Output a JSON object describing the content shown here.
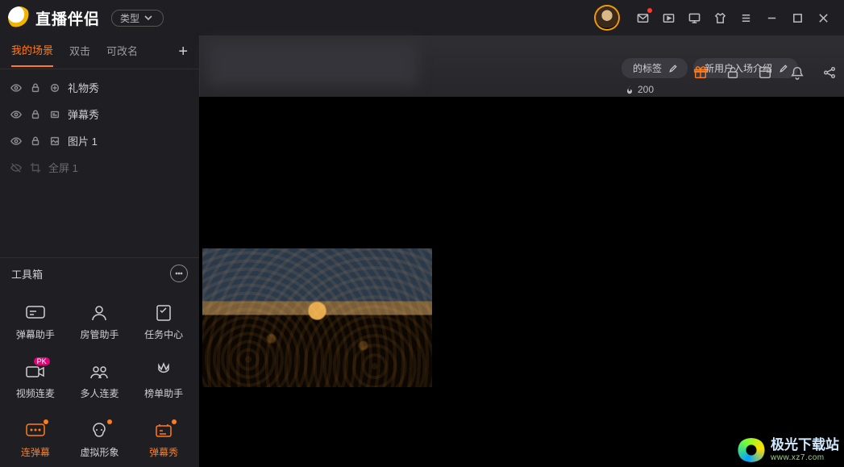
{
  "app": {
    "title": "直播伴侣",
    "type_label": "类型"
  },
  "titlebar_icons": [
    "mail",
    "video-play",
    "monitor",
    "shirt",
    "menu",
    "minimize",
    "maximize",
    "close"
  ],
  "sidebar": {
    "tabs": [
      {
        "label": "我的场景",
        "active": true
      },
      {
        "label": "双击",
        "active": false
      },
      {
        "label": "可改名",
        "active": false
      }
    ],
    "layers": [
      {
        "name": "礼物秀",
        "visible": true,
        "locked": true,
        "type": "gift"
      },
      {
        "name": "弹幕秀",
        "visible": true,
        "locked": true,
        "type": "danmu"
      },
      {
        "name": "图片 1",
        "visible": true,
        "locked": true,
        "type": "image"
      },
      {
        "name": "全屏 1",
        "visible": false,
        "locked": false,
        "type": "fullscreen",
        "dim": true
      }
    ]
  },
  "toolbox": {
    "title": "工具箱",
    "items": [
      {
        "label": "弹幕助手",
        "icon": "danmu-assistant"
      },
      {
        "label": "房管助手",
        "icon": "room-admin"
      },
      {
        "label": "任务中心",
        "icon": "task-center"
      },
      {
        "label": "视频连麦",
        "icon": "video-link",
        "badge": "PK"
      },
      {
        "label": "多人连麦",
        "icon": "multi-link"
      },
      {
        "label": "榜单助手",
        "icon": "rank-assistant"
      },
      {
        "label": "连弹幕",
        "icon": "lian-danmu",
        "orange": true,
        "dot": true
      },
      {
        "label": "虚拟形象",
        "icon": "virtual-avatar",
        "dot": true
      },
      {
        "label": "弹幕秀",
        "icon": "danmu-show",
        "orange": true,
        "dot": true
      }
    ]
  },
  "maintop": {
    "tag1": "的标签",
    "tag2": "新用户入场介绍",
    "count": "200"
  },
  "action_icons": [
    {
      "name": "gift-icon",
      "color": "#ff7b1c"
    },
    {
      "name": "unlock-icon"
    },
    {
      "name": "box-icon"
    },
    {
      "name": "bell-icon"
    },
    {
      "name": "share-icon"
    }
  ],
  "watermark": {
    "main": "极光下载站",
    "sub": "www.xz7.com"
  }
}
